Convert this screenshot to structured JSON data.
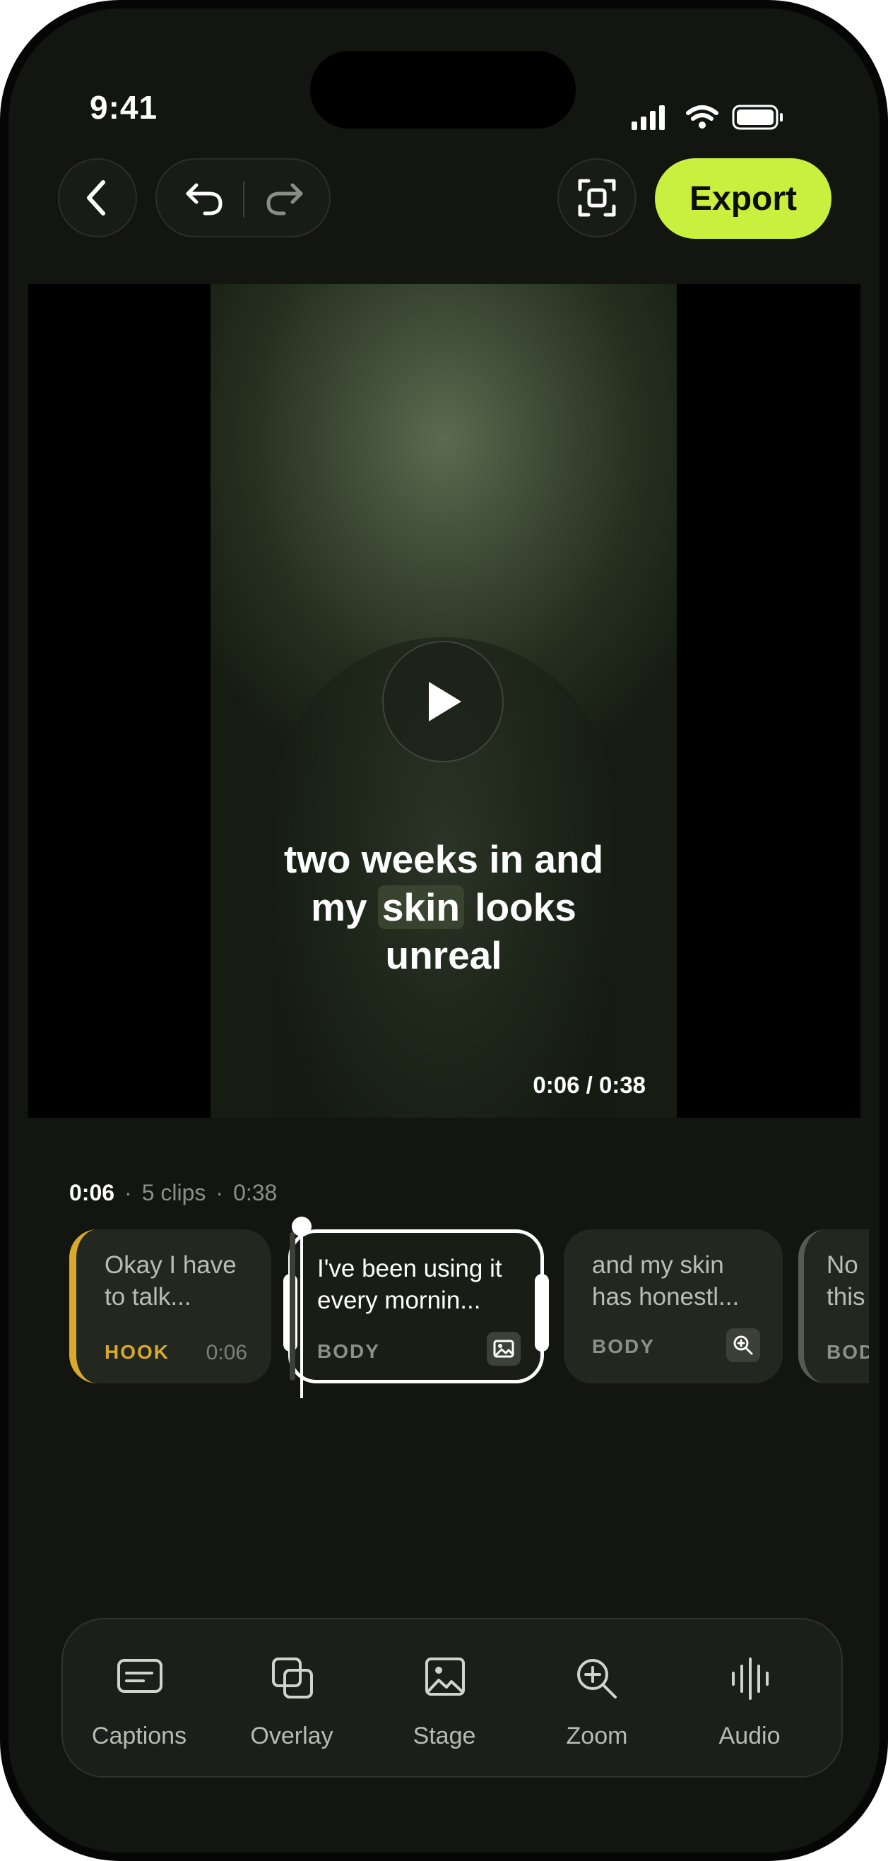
{
  "status_bar": {
    "time": "9:41"
  },
  "top_bar": {
    "export_label": "Export"
  },
  "preview": {
    "caption_line1": "two weeks in and",
    "caption_line2_pre": "my",
    "caption_line2_hl": "skin",
    "caption_line2_post": "looks",
    "caption_line3": "unreal",
    "time_readout": "0:06 / 0:38"
  },
  "timeline": {
    "current": "0:06",
    "clips_count": "5 clips",
    "total": "0:38",
    "clips": [
      {
        "text": "Okay I have to talk...",
        "tag": "HOOK",
        "duration": "0:06"
      },
      {
        "text": "I've been using it every mornin...",
        "tag": "BODY",
        "icon": "image-icon"
      },
      {
        "text": "and my skin has honestl...",
        "tag": "BODY",
        "icon": "zoom-in-icon"
      },
      {
        "text": "No this",
        "tag": "BOD"
      }
    ]
  },
  "toolbar": {
    "items": [
      {
        "label": "Captions",
        "icon": "captions-icon"
      },
      {
        "label": "Overlay",
        "icon": "overlay-icon"
      },
      {
        "label": "Stage",
        "icon": "stage-icon"
      },
      {
        "label": "Zoom",
        "icon": "zoom-icon"
      },
      {
        "label": "Audio",
        "icon": "audio-icon"
      }
    ]
  },
  "colors": {
    "accent": "#c9ef3f",
    "hook": "#d8a92a",
    "background": "#121510"
  }
}
